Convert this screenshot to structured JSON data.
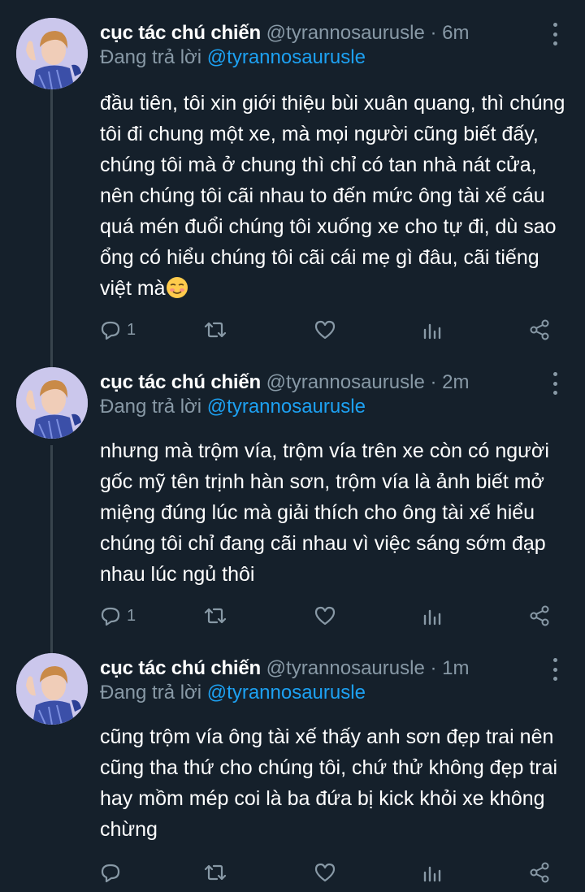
{
  "colors": {
    "background": "#15202b",
    "text": "#ffffff",
    "muted": "#8899a6",
    "link": "#1da1f2",
    "thread_line": "#38444d"
  },
  "tweets": [
    {
      "display_name": "cục tác chú chiến",
      "handle": "@tyrannosaurusle",
      "separator": "·",
      "time": "6m",
      "reply_prefix": "Đang trả lời",
      "reply_to": "@tyrannosaurusle",
      "text": "đầu tiên, tôi xin giới thiệu bùi xuân quang, thì chúng tôi đi chung một xe, mà mọi người cũng biết đấy, chúng tôi mà ở chung thì chỉ có tan nhà nát cửa, nên chúng tôi cãi nhau to đến mức ông tài xế cáu quá mén đuổi chúng tôi xuống xe cho tự đi, dù sao ổng có hiểu chúng tôi cãi cái mẹ gì đâu, cãi tiếng việt mà",
      "emoji": "smiling-face-with-blush-emoji",
      "reply_count": "1",
      "icons": [
        "reply-icon",
        "retweet-icon",
        "like-icon",
        "analytics-icon",
        "share-icon",
        "more-options-icon"
      ]
    },
    {
      "display_name": "cục tác chú chiến",
      "handle": "@tyrannosaurusle",
      "separator": "·",
      "time": "2m",
      "reply_prefix": "Đang trả lời",
      "reply_to": "@tyrannosaurusle",
      "text": "nhưng mà trộm vía, trộm vía trên xe còn có người gốc mỹ tên trịnh hàn sơn, trộm vía là ảnh biết mở miệng đúng lúc mà giải thích cho ông tài xế hiểu chúng tôi chỉ đang cãi nhau vì việc sáng sớm đạp nhau lúc ngủ thôi",
      "reply_count": "1",
      "icons": [
        "reply-icon",
        "retweet-icon",
        "like-icon",
        "analytics-icon",
        "share-icon",
        "more-options-icon"
      ]
    },
    {
      "display_name": "cục tác chú chiến",
      "handle": "@tyrannosaurusle",
      "separator": "·",
      "time": "1m",
      "reply_prefix": "Đang trả lời",
      "reply_to": "@tyrannosaurusle",
      "text": "cũng trộm vía ông tài xế thấy anh sơn đẹp trai nên cũng tha thứ cho chúng tôi, chứ thử không đẹp trai hay mồm mép coi là ba đứa bị kick khỏi xe không chừng",
      "reply_count": "",
      "icons": [
        "reply-icon",
        "retweet-icon",
        "like-icon",
        "analytics-icon",
        "share-icon",
        "more-options-icon"
      ]
    }
  ]
}
